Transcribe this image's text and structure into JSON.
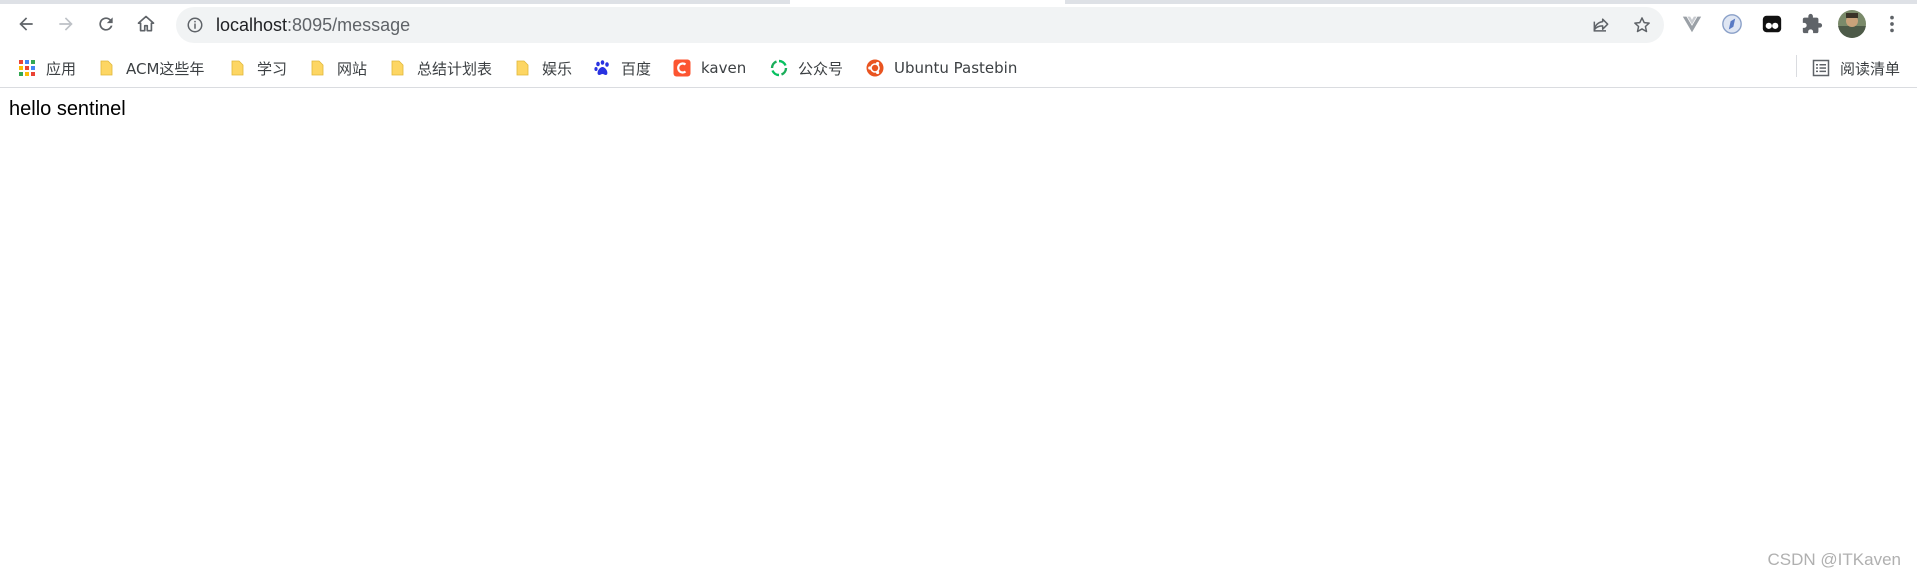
{
  "browser": {
    "address_bar": {
      "host": "localhost",
      "path": ":8095/message"
    },
    "bookmarks": [
      {
        "label": "应用",
        "icon": "apps-grid-icon"
      },
      {
        "label": "ACM这些年",
        "icon": "folder-icon"
      },
      {
        "label": "学习",
        "icon": "folder-icon"
      },
      {
        "label": "网站",
        "icon": "folder-icon"
      },
      {
        "label": "总结计划表",
        "icon": "folder-icon"
      },
      {
        "label": "娱乐",
        "icon": "folder-icon"
      },
      {
        "label": "百度",
        "icon": "baidu-paw-icon"
      },
      {
        "label": "kaven",
        "icon": "csdn-icon"
      },
      {
        "label": "公众号",
        "icon": "wechat-icon"
      },
      {
        "label": "Ubuntu Pastebin",
        "icon": "ubuntu-icon"
      }
    ],
    "reading_list": {
      "label": "阅读清单",
      "icon": "reading-list-icon"
    }
  },
  "page": {
    "body_text": "hello sentinel"
  },
  "watermark": "CSDN @ITKaven",
  "colors": {
    "folder": "#fdd663",
    "baidu": "#2932e1",
    "csdn": "#fc5531",
    "wechat": "#07c160",
    "ubuntu": "#e95420"
  }
}
